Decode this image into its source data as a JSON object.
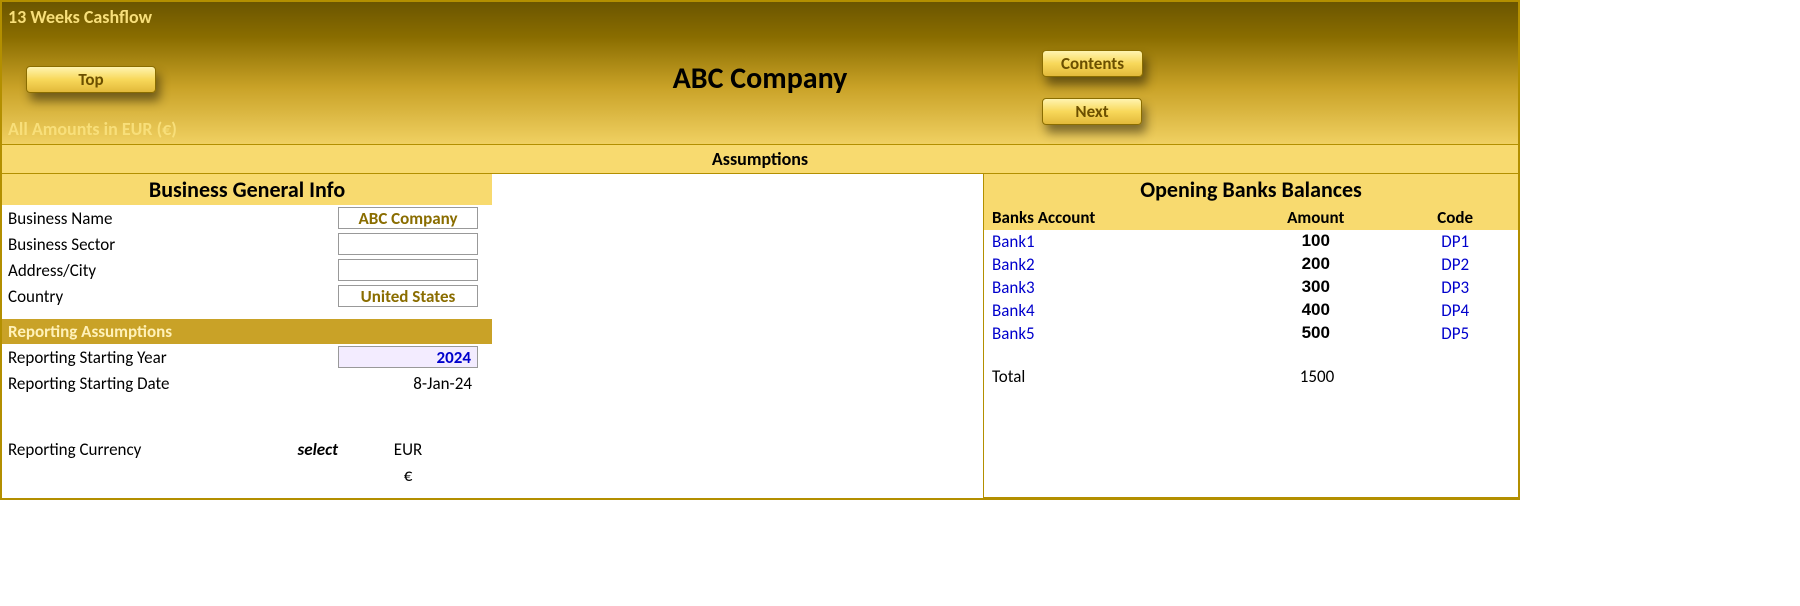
{
  "header": {
    "title": "13 Weeks Cashflow",
    "subtitle": "All Amounts in  EUR (€)",
    "company": "ABC Company",
    "buttons": {
      "top": "Top",
      "contents": "Contents",
      "next": "Next"
    }
  },
  "section_bar": "Assumptions",
  "business_info": {
    "panel_title": "Business General Info",
    "rows": {
      "name_label": "Business Name",
      "name_value": "ABC Company",
      "sector_label": "Business Sector",
      "sector_value": "",
      "address_label": "Address/City",
      "address_value": "",
      "country_label": "Country",
      "country_value": "United States"
    }
  },
  "reporting": {
    "subheader": "Reporting Assumptions",
    "year_label": "Reporting Starting Year",
    "year_value": "2024",
    "date_label": "Reporting Starting Date",
    "date_value": "8-Jan-24",
    "currency_label": "Reporting Currency",
    "currency_hint": "select",
    "currency_value": "EUR",
    "currency_symbol": "€"
  },
  "banks": {
    "panel_title": "Opening Banks Balances",
    "headers": {
      "c1": "Banks Account",
      "c2": "Amount",
      "c3": "Code"
    },
    "rows": [
      {
        "name": "Bank1",
        "amount": "100",
        "code": "DP1"
      },
      {
        "name": "Bank2",
        "amount": "200",
        "code": "DP2"
      },
      {
        "name": "Bank3",
        "amount": "300",
        "code": "DP3"
      },
      {
        "name": "Bank4",
        "amount": "400",
        "code": "DP4"
      },
      {
        "name": "Bank5",
        "amount": "500",
        "code": "DP5"
      }
    ],
    "total_label": "Total",
    "total_value": "1500"
  }
}
